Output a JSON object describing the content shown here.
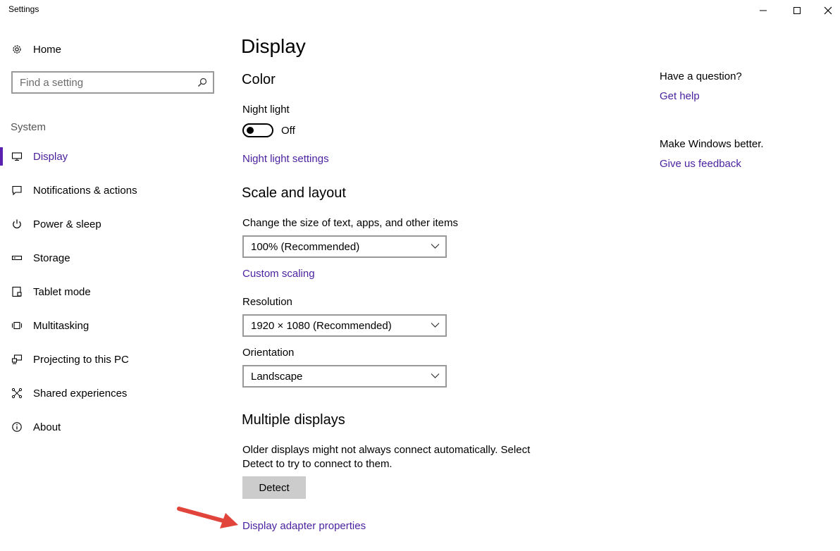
{
  "window": {
    "title": "Settings"
  },
  "sidebar": {
    "home_label": "Home",
    "search": {
      "placeholder": "Find a setting",
      "value": ""
    },
    "section_label": "System",
    "items": [
      {
        "label": "Display",
        "icon": "monitor-icon",
        "active": true
      },
      {
        "label": "Notifications & actions",
        "icon": "notification-icon",
        "active": false
      },
      {
        "label": "Power & sleep",
        "icon": "power-icon",
        "active": false
      },
      {
        "label": "Storage",
        "icon": "storage-icon",
        "active": false
      },
      {
        "label": "Tablet mode",
        "icon": "tablet-icon",
        "active": false
      },
      {
        "label": "Multitasking",
        "icon": "multitasking-icon",
        "active": false
      },
      {
        "label": "Projecting to this PC",
        "icon": "projecting-icon",
        "active": false
      },
      {
        "label": "Shared experiences",
        "icon": "shared-icon",
        "active": false
      },
      {
        "label": "About",
        "icon": "info-icon",
        "active": false
      }
    ]
  },
  "main": {
    "title": "Display",
    "color": {
      "heading": "Color",
      "night_light_label": "Night light",
      "night_light_state": "Off",
      "night_light_on": false,
      "night_light_settings_link": "Night light settings"
    },
    "scale": {
      "heading": "Scale and layout",
      "size_label": "Change the size of text, apps, and other items",
      "size_value": "100% (Recommended)",
      "custom_scaling_link": "Custom scaling",
      "resolution_label": "Resolution",
      "resolution_value": "1920 × 1080 (Recommended)",
      "orientation_label": "Orientation",
      "orientation_value": "Landscape"
    },
    "multiple": {
      "heading": "Multiple displays",
      "description_line1": "Older displays might not always connect automatically. Select",
      "description_line2": "Detect to try to connect to them.",
      "detect_button": "Detect",
      "adapter_link": "Display adapter properties"
    }
  },
  "aside": {
    "question_heading": "Have a question?",
    "get_help_link": "Get help",
    "feedback_heading": "Make Windows better.",
    "feedback_link": "Give us feedback"
  },
  "colors": {
    "accent": "#4b22a0",
    "active_bar": "#5a20b0",
    "annotation_arrow": "#e0443a",
    "button_bg": "#cccccc"
  }
}
